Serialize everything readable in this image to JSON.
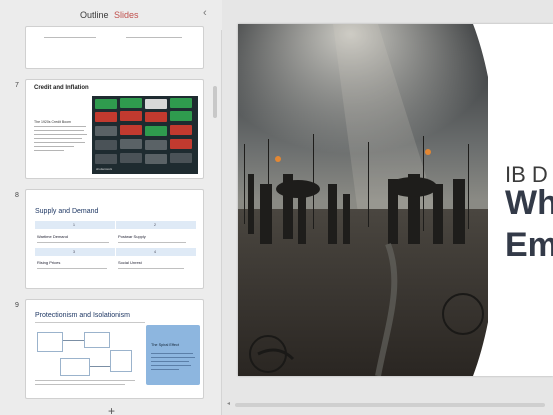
{
  "tabs": {
    "outline": "Outline",
    "slides": "Slides"
  },
  "colors": {
    "active_tab": "#c0504d",
    "title_blue": "#1f3864",
    "effect_box": "#8db6df"
  },
  "thumbnails": {
    "slide7": {
      "number": "7",
      "title": "Credit and Inflation",
      "subtitle": "The 1920s Credit Boom",
      "photo_caption": "shutterstock"
    },
    "slide8": {
      "number": "8",
      "title": "Supply and Demand",
      "cells": [
        {
          "n": "1",
          "label": "Wartime Demand"
        },
        {
          "n": "2",
          "label": "Postwar Supply"
        },
        {
          "n": "3",
          "label": "Rising Prices"
        },
        {
          "n": "4",
          "label": "Social Unrest"
        }
      ]
    },
    "slide9": {
      "number": "9",
      "title": "Protectionism and Isolationism",
      "effect_title": "The Spiral Effect"
    }
  },
  "add_slide_label": "+",
  "main_slide": {
    "heading_small": "IB D",
    "heading_big_line1": "Wh",
    "heading_big_line2": "Em"
  }
}
